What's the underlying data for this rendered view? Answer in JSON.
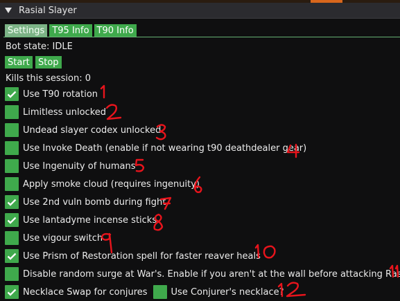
{
  "window": {
    "title": "Rasial Slayer"
  },
  "tabs": [
    {
      "label": "Settings",
      "active": true
    },
    {
      "label": "T95 Info",
      "active": false
    },
    {
      "label": "T90 Info",
      "active": false
    }
  ],
  "status": {
    "bot_state": "Bot state: IDLE",
    "kills": "Kills this session: 0"
  },
  "buttons": {
    "start": "Start",
    "stop": "Stop"
  },
  "options": [
    {
      "label": "Use T90 rotation",
      "checked": true
    },
    {
      "label": "Limitless unlocked",
      "checked": false
    },
    {
      "label": "Undead slayer codex unlocked",
      "checked": false
    },
    {
      "label": "Use Invoke Death (enable if not wearing t90 deathdealer gear)",
      "checked": false
    },
    {
      "label": "Use Ingenuity of humans",
      "checked": false
    },
    {
      "label": "Apply smoke cloud (requires ingenuity)",
      "checked": false
    },
    {
      "label": "Use 2nd vuln bomb during fight",
      "checked": true
    },
    {
      "label": "Use lantadyme incense sticks",
      "checked": true
    },
    {
      "label": "Use vigour switch",
      "checked": false
    },
    {
      "label": "Use Prism of Restoration spell for faster reaver heals",
      "checked": true
    },
    {
      "label": "Disable random surge at War's. Enable if you aren't at the wall before attacking Rasial.",
      "checked": false
    },
    {
      "label": "Necklace Swap for conjures",
      "checked": true
    }
  ],
  "extra_option": {
    "label": "Use Conjurer's necklace?",
    "checked": false
  },
  "annotations": [
    "1",
    "2",
    "3",
    "4",
    "5",
    "6",
    "7",
    "8",
    "9",
    "10",
    "11",
    "12"
  ],
  "colors": {
    "accent_green": "#3fa94c",
    "active_tab": "#7cb386",
    "annotation_red": "#e8141c",
    "background": "#0f0f10",
    "titlebar": "#2b2b2f"
  }
}
